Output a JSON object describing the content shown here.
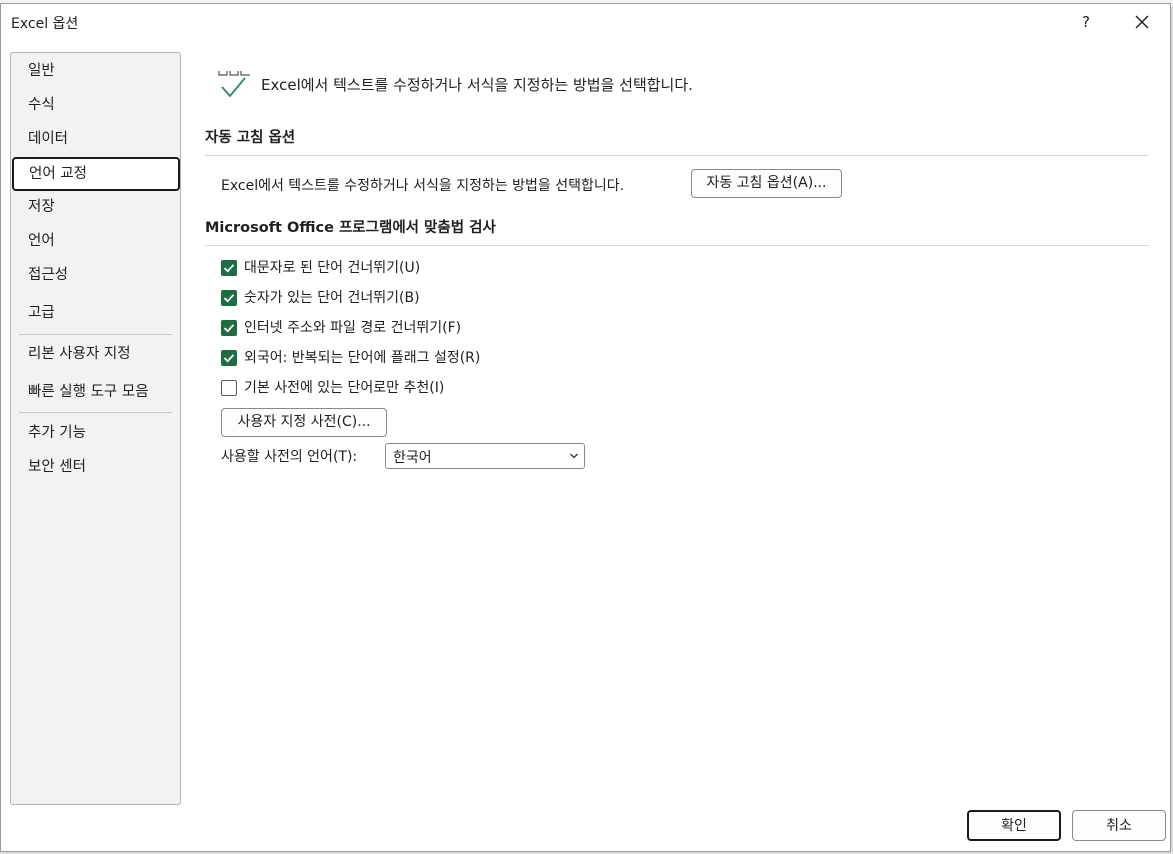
{
  "window": {
    "title": "Excel 옵션",
    "help_label": "?"
  },
  "sidebar": {
    "items": [
      {
        "label": "일반"
      },
      {
        "label": "수식"
      },
      {
        "label": "데이터"
      },
      {
        "label": "언어 교정",
        "selected": true
      },
      {
        "label": "저장"
      },
      {
        "label": "언어"
      },
      {
        "label": "접근성"
      },
      {
        "label": "고급"
      },
      {
        "label": "리본 사용자 지정"
      },
      {
        "label": "빠른 실행 도구 모음"
      },
      {
        "label": "추가 기능"
      },
      {
        "label": "보안 센터"
      }
    ]
  },
  "header": {
    "icon": "proofing-abc-check-icon",
    "text": "Excel에서 텍스트를 수정하거나 서식을 지정하는 방법을 선택합니다."
  },
  "autocorrect_section": {
    "title": "자동 고침 옵션",
    "description": "Excel에서 텍스트를 수정하거나 서식을 지정하는 방법을 선택합니다.",
    "button_label": "자동 고침 옵션(A)..."
  },
  "spelling_section": {
    "title": "Microsoft Office 프로그램에서 맞춤법 검사",
    "options": [
      {
        "label": "대문자로 된 단어 건너뛰기(U)",
        "checked": true
      },
      {
        "label": "숫자가 있는 단어 건너뛰기(B)",
        "checked": true
      },
      {
        "label": "인터넷 주소와 파일 경로 건너뛰기(F)",
        "checked": true
      },
      {
        "label": "외국어: 반복되는 단어에 플래그 설정(R)",
        "checked": true
      },
      {
        "label": "기본 사전에 있는 단어로만 추천(I)",
        "checked": false
      }
    ],
    "custom_dict_button": "사용자 지정 사전(C)...",
    "dictionary_language_label": "사용할 사전의 언어(T):",
    "dictionary_language_value": "한국어"
  },
  "footer": {
    "ok_label": "확인",
    "cancel_label": "취소"
  },
  "colors": {
    "checkbox_checked": "#1e6c41",
    "selected_border": "#1a1a1a"
  }
}
